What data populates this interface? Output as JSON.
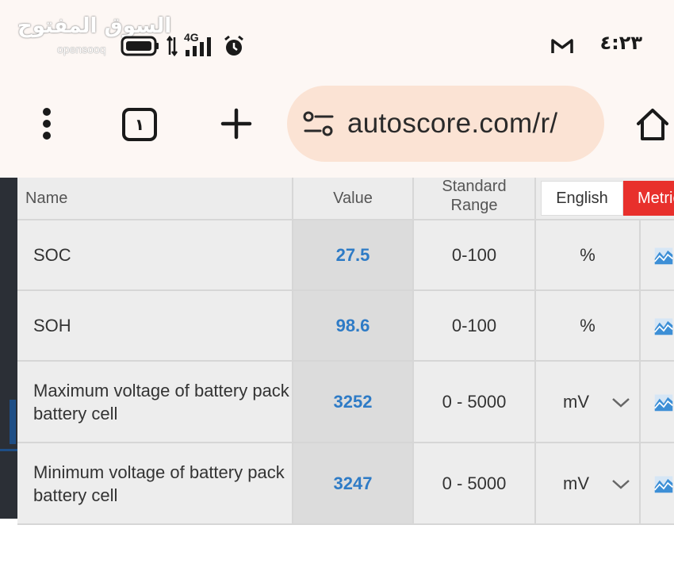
{
  "status_bar": {
    "watermark_arabic": "السوق المفتوح",
    "watermark_english": "opensooq",
    "network": "4G",
    "time": "٤:٢٣",
    "icons": [
      "battery-icon",
      "data-arrows-icon",
      "signal-icon",
      "alarm-icon",
      "gmail-icon"
    ]
  },
  "browser": {
    "tab_count": "١",
    "url": "autoscore.com/r/",
    "icons": [
      "more-vert-icon",
      "tab-switcher-icon",
      "plus-icon",
      "site-settings-icon",
      "home-icon"
    ]
  },
  "table": {
    "headers": {
      "name": "Name",
      "value": "Value",
      "range_line1": "Standard",
      "range_line2": "Range"
    },
    "unit_toggle": {
      "english": "English",
      "metric": "Metric",
      "active": "metric"
    },
    "rows": [
      {
        "name": "SOC",
        "value": "27.5",
        "range": "0-100",
        "unit": "%",
        "has_dropdown": false
      },
      {
        "name": "SOH",
        "value": "98.6",
        "range": "0-100",
        "unit": "%",
        "has_dropdown": false
      },
      {
        "name": "Maximum voltage of battery pack battery cell",
        "value": "3252",
        "range": "0 - 5000",
        "unit": "mV",
        "has_dropdown": true
      },
      {
        "name": "Minimum voltage of battery pack battery cell",
        "value": "3247",
        "range": "0 - 5000",
        "unit": "mV",
        "has_dropdown": true
      }
    ]
  },
  "colors": {
    "value_text": "#2e7bc6",
    "metric_active": "#e8302c",
    "url_bar": "#fbe3d4",
    "chrome_bg": "#fdf7f4"
  }
}
